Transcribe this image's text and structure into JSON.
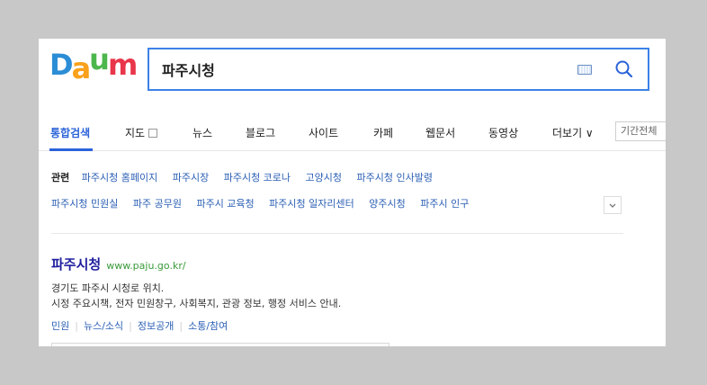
{
  "logo": {
    "text_d": "D",
    "text_a": "a",
    "text_u": "u",
    "text_m": "m"
  },
  "search": {
    "query": "파주시청"
  },
  "tabs": [
    {
      "label": "통합검색",
      "active": true
    },
    {
      "label": "지도"
    },
    {
      "label": "뉴스"
    },
    {
      "label": "블로그"
    },
    {
      "label": "사이트"
    },
    {
      "label": "카페"
    },
    {
      "label": "웹문서"
    },
    {
      "label": "동영상"
    },
    {
      "label": "더보기 ∨"
    }
  ],
  "period_filter": "기간전체",
  "related": {
    "label": "관련",
    "links_row1": [
      "파주시청 홈페이지",
      "파주시장",
      "파주시청 코로나",
      "고양시청",
      "파주시청 인사발령"
    ],
    "links_row2": [
      "파주시청 민원실",
      "파주 공무원",
      "파주시 교육청",
      "파주시청 일자리센터",
      "양주시청",
      "파주시 인구"
    ]
  },
  "result": {
    "title": "파주시청",
    "url": "www.paju.go.kr/",
    "desc_line1": "경기도 파주시 시청로 위치.",
    "desc_line2": "시정 주요시책, 전자 민원창구, 사회복지, 관광 정보, 행정 서비스 안내.",
    "sublinks": [
      "민원",
      "뉴스/소식",
      "정보공개",
      "소통/참여"
    ]
  },
  "colors": {
    "accent": "#2b63d9",
    "link": "#2b5fb4",
    "url_green": "#3a9a3a",
    "search_border": "#3b82e6"
  }
}
